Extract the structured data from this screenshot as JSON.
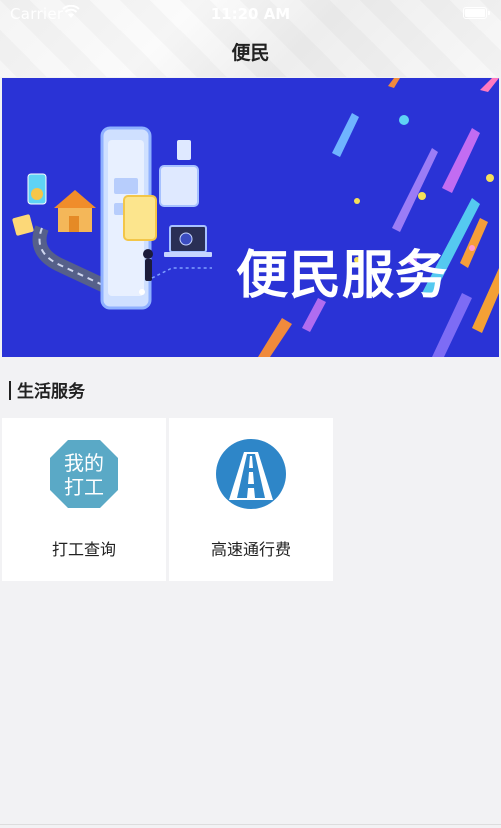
{
  "status_bar": {
    "carrier": "Carrier",
    "time": "11:20 AM"
  },
  "nav": {
    "title": "便民"
  },
  "banner": {
    "text": "便民服务",
    "background": "#2a33d6"
  },
  "section": {
    "title": "生活服务"
  },
  "services": [
    {
      "label": "打工查询",
      "icon": "my-work-icon",
      "icon_text_line1": "我的",
      "icon_text_line2": "打工",
      "color": "#5aa9c6"
    },
    {
      "label": "高速通行费",
      "icon": "highway-toll-icon",
      "color": "#2e86c8"
    }
  ]
}
